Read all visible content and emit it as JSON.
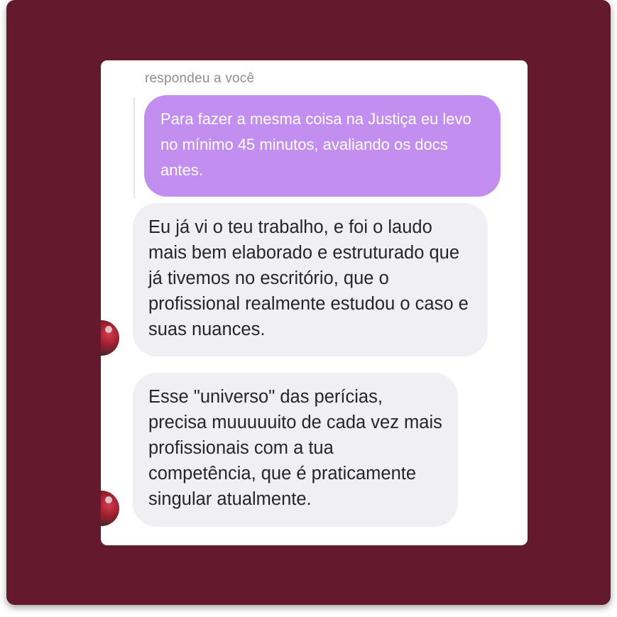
{
  "colors": {
    "background": "#641a2c",
    "card": "#ffffff",
    "quoted_bubble": "#c28ff0",
    "incoming_bubble": "#efeff4",
    "label_gray": "#8e8e8e"
  },
  "reply": {
    "label": "respondeu a você",
    "quoted_text": "Para fazer a mesma coisa na Justiça eu levo no mínimo 45 minutos, avaliando os docs antes."
  },
  "messages": [
    {
      "text": "Eu já vi o teu trabalho, e foi o laudo mais bem elaborado e estruturado que já tivemos no escritório, que o profissional realmente estudou o caso e suas nuances.",
      "avatar_icon": "user-avatar"
    },
    {
      "text": "Esse \"universo\" das perícias, precisa muuuuuito de cada vez mais profissionais com a tua competência, que é praticamente singular atualmente.",
      "avatar_icon": "user-avatar"
    }
  ]
}
